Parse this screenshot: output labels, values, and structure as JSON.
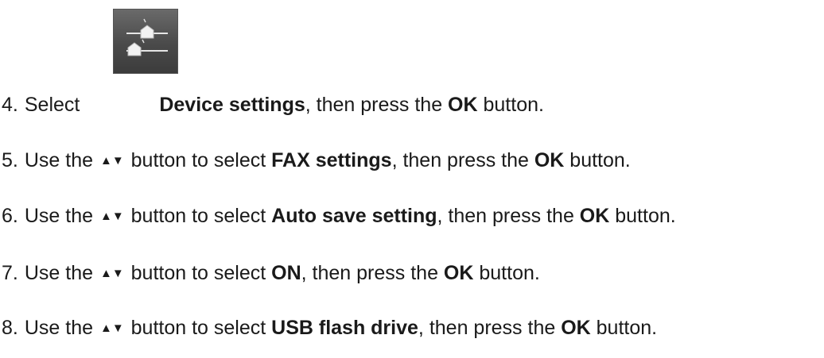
{
  "steps": [
    {
      "num": "4.",
      "pre": "Select",
      "icon": "device-settings-icon",
      "bold": "Device settings",
      "mid": ", then press the ",
      "ok": "OK",
      "post": " button."
    },
    {
      "num": "5.",
      "pre": "Use the",
      "arrows": "▲▼",
      "pre2": " button to select ",
      "bold": "FAX settings",
      "mid": ", then press the ",
      "ok": "OK",
      "post": " button."
    },
    {
      "num": "6.",
      "pre": "Use the",
      "arrows": "▲▼",
      "pre2": " button to select ",
      "bold": "Auto save setting",
      "mid": ", then press the ",
      "ok": "OK",
      "post": " button."
    },
    {
      "num": "7.",
      "pre": "Use the",
      "arrows": "▲▼",
      "pre2": " button to select ",
      "bold": "ON",
      "mid": ", then press the ",
      "ok": "OK",
      "post": " button."
    },
    {
      "num": "8.",
      "pre": "Use the",
      "arrows": "▲▼",
      "pre2": " button to select ",
      "bold": "USB flash drive",
      "mid": ", then press the ",
      "ok": "OK",
      "post": " button."
    }
  ]
}
